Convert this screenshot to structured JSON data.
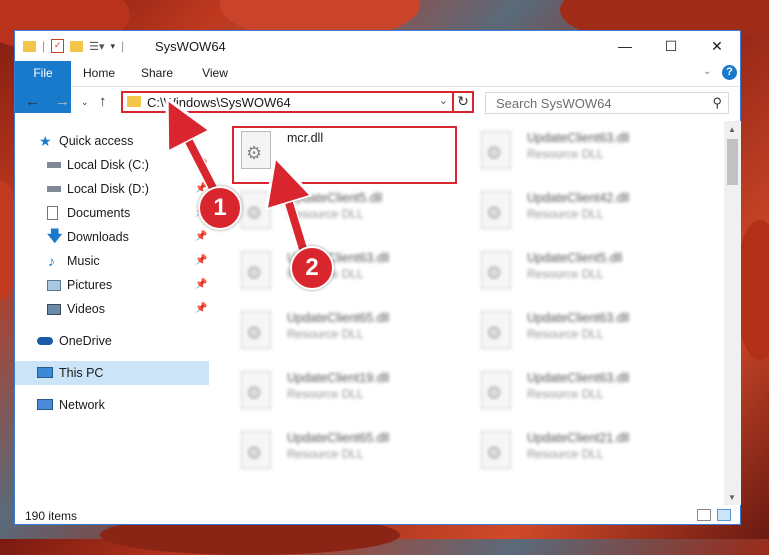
{
  "window": {
    "title": "SysWOW64"
  },
  "ribbon": {
    "tabs": [
      "File",
      "Home",
      "Share",
      "View"
    ]
  },
  "address": {
    "path": "C:\\Windows\\SysWOW64"
  },
  "search": {
    "placeholder": "Search SysWOW64"
  },
  "nav": {
    "items": [
      {
        "label": "Quick access",
        "icon": "star-icon",
        "pinned": false
      },
      {
        "label": "Local Disk (C:)",
        "icon": "drive-icon",
        "pinned": true
      },
      {
        "label": "Local Disk (D:)",
        "icon": "drive-icon",
        "pinned": true
      },
      {
        "label": "Documents",
        "icon": "documents-icon",
        "pinned": true
      },
      {
        "label": "Downloads",
        "icon": "download-icon",
        "pinned": true
      },
      {
        "label": "Music",
        "icon": "music-icon",
        "pinned": true
      },
      {
        "label": "Pictures",
        "icon": "pictures-icon",
        "pinned": true
      },
      {
        "label": "Videos",
        "icon": "videos-icon",
        "pinned": true
      },
      {
        "label": "OneDrive",
        "icon": "cloud-icon",
        "pinned": false
      },
      {
        "label": "This PC",
        "icon": "computer-icon",
        "pinned": false
      },
      {
        "label": "Network",
        "icon": "network-icon",
        "pinned": false
      }
    ]
  },
  "files": {
    "highlighted": {
      "name": "mcr.dll",
      "type": ""
    },
    "blurred": [
      {
        "name": "UpdateClient63.dll",
        "type": "Resource DLL"
      },
      {
        "name": "UpdateClient5.dll",
        "type": "Resource DLL"
      },
      {
        "name": "UpdateClient42.dll",
        "type": "Resource DLL"
      },
      {
        "name": "UpdateClient63.dll",
        "type": "Resource DLL"
      },
      {
        "name": "UpdateClient5.dll",
        "type": "Resource DLL"
      },
      {
        "name": "UpdateClient65.dll",
        "type": "Resource DLL"
      },
      {
        "name": "UpdateClient63.dll",
        "type": "Resource DLL"
      },
      {
        "name": "UpdateClient19.dll",
        "type": "Resource DLL"
      },
      {
        "name": "UpdateClient63.dll",
        "type": "Resource DLL"
      },
      {
        "name": "UpdateClient65.dll",
        "type": "Resource DLL"
      },
      {
        "name": "UpdateClient21.dll",
        "type": "Resource DLL"
      }
    ]
  },
  "status": {
    "item_count": "190 items"
  },
  "callouts": [
    "1",
    "2"
  ],
  "colors": {
    "accent": "#1979ca",
    "highlight": "#d9262e",
    "selected": "#cce4f7"
  }
}
